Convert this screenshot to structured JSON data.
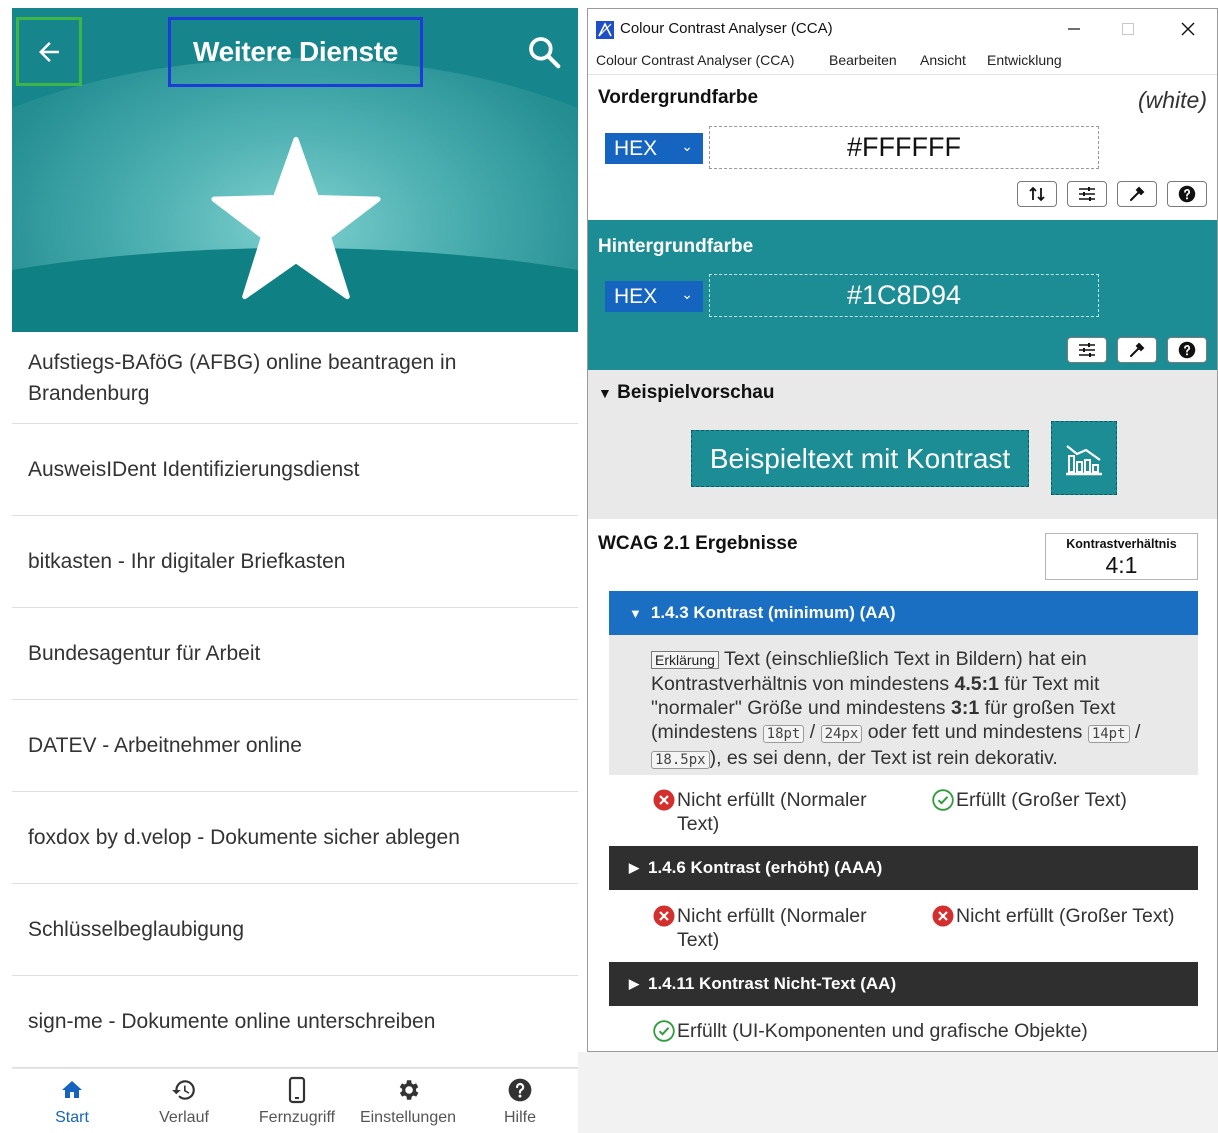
{
  "app": {
    "title": "Weitere Dienste",
    "services": [
      "Aufstiegs-BAföG (AFBG) online beantragen in Brandenburg",
      "AusweisIDent Identifizierungsdienst",
      "bitkasten - Ihr digitaler Briefkasten",
      "Bundesagentur für Arbeit",
      "DATEV - Arbeitnehmer online",
      "foxdox by d.velop - Dokumente sicher ablegen",
      "Schlüsselbeglaubigung",
      "sign-me - Dokumente online unterschreiben"
    ],
    "nav": [
      {
        "label": "Start",
        "icon": "home-icon",
        "active": true
      },
      {
        "label": "Verlauf",
        "icon": "history-icon",
        "active": false
      },
      {
        "label": "Fernzugriff",
        "icon": "smartphone-icon",
        "active": false
      },
      {
        "label": "Einstellungen",
        "icon": "gear-icon",
        "active": false
      },
      {
        "label": "Hilfe",
        "icon": "help-icon",
        "active": false
      }
    ],
    "colors": {
      "header": "#17858c",
      "back_highlight": "#3fb548",
      "title_highlight": "#1d3bd6",
      "nav_active": "#1565c0"
    }
  },
  "cca": {
    "window_title": "Colour Contrast Analyser (CCA)",
    "menu": [
      "Colour Contrast Analyser (CCA)",
      "Bearbeiten",
      "Ansicht",
      "Entwicklung"
    ],
    "foreground": {
      "label": "Vordergrundfarbe",
      "name": "(white)",
      "format": "HEX",
      "value": "#FFFFFF"
    },
    "background": {
      "label": "Hintergrundfarbe",
      "format": "HEX",
      "value": "#1C8D94"
    },
    "preview": {
      "label": "Beispielvorschau",
      "text": "Beispieltext mit Kontrast"
    },
    "wcag": {
      "title": "WCAG 2.1 Ergebnisse",
      "ratio_label": "Kontrastverhältnis",
      "ratio_value": "4:1",
      "criteria": [
        {
          "title": "1.4.3 Kontrast (minimum) (AA)",
          "expanded": true,
          "explanation_tag": "Erklärung",
          "explanation": {
            "p1": "Text (einschließlich Text in Bildern) hat ein Kontrastverhältnis von mindestens ",
            "b1": "4.5:1",
            "p2": " für Text mit \"normaler\" Größe und mindestens ",
            "b2": "3:1",
            "p3": " für großen Text (mindestens ",
            "k1": "18pt",
            "s1": " / ",
            "k2": "24px",
            "p4": " oder fett und mindestens ",
            "k3": "14pt",
            "s2": " / ",
            "k4": "18.5px",
            "p5": "), es sei denn, der Text ist rein dekorativ."
          },
          "results": [
            {
              "text": "Nicht erfüllt (Normaler Text)",
              "pass": false
            },
            {
              "text": "Erfüllt (Großer Text)",
              "pass": true
            }
          ]
        },
        {
          "title": "1.4.6 Kontrast (erhöht) (AAA)",
          "expanded": false,
          "results": [
            {
              "text": "Nicht erfüllt (Normaler Text)",
              "pass": false
            },
            {
              "text": "Nicht erfüllt (Großer Text)",
              "pass": false
            }
          ]
        },
        {
          "title": "1.4.11 Kontrast Nicht-Text (AA)",
          "expanded": false,
          "results": [
            {
              "text": "Erfüllt (UI-Komponenten und grafische Objekte)",
              "pass": true
            }
          ]
        }
      ]
    },
    "colors": {
      "accent": "#1565c0",
      "sample_bg": "#1C8D94",
      "fail": "#d32f2f",
      "pass": "#2e9d3a",
      "dark_header": "#2f2f2f"
    }
  }
}
